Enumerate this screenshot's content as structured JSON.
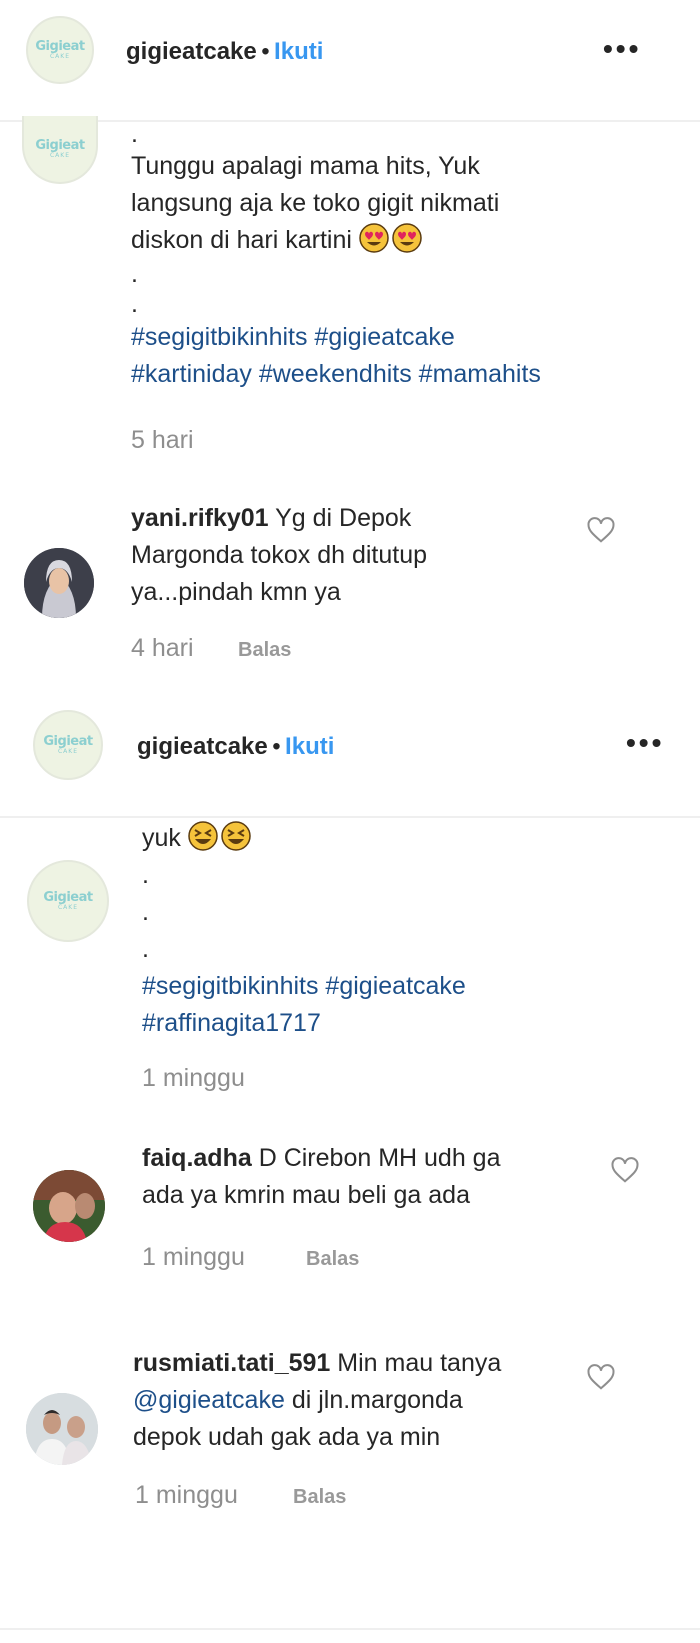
{
  "section1": {
    "header": {
      "username": "gigieatcake",
      "separator": "•",
      "follow_label": "Ikuti",
      "more_icon": "more-dots-icon"
    },
    "caption_lines": [
      ".",
      "Tunggu apalagi mama hits, Yuk",
      "langsung aja ke toko gigit nikmati",
      "diskon di hari kartini",
      ".",
      "."
    ],
    "caption_emoji": "heart-eyes-emoji",
    "hashtags_line1": "#segigitbikinhits #gigieatcake",
    "hashtags_line2": "#kartiniday #weekendhits #mamahits",
    "time": "5 hari",
    "comment": {
      "username": "yani.rifky01",
      "lines": [
        "Yg di Depok",
        "Margonda tokox dh ditutup",
        "ya...pindah kmn ya"
      ],
      "time": "4 hari",
      "reply_label": "Balas"
    }
  },
  "section2": {
    "header": {
      "username": "gigieatcake",
      "separator": "•",
      "follow_label": "Ikuti",
      "more_icon": "more-dots-icon"
    },
    "caption_first": "yuk",
    "caption_emoji": "laughing-emoji",
    "caption_dots": [
      ".",
      ".",
      "."
    ],
    "hashtags_line1": "#segigitbikinhits #gigieatcake",
    "hashtags_line2": "#raffinagita1717",
    "time": "1 minggu",
    "comments": [
      {
        "username": "faiq.adha",
        "lines": [
          "D Cirebon MH udh ga",
          "ada ya kmrin mau beli ga ada"
        ],
        "time": "1 minggu",
        "reply_label": "Balas"
      },
      {
        "username": "rusmiati.tati_591",
        "line1": "Min mau tanya",
        "mention": "@gigieatcake",
        "line2_rest": "di jln.margonda",
        "line3": "depok udah gak ada ya min",
        "time": "1 minggu",
        "reply_label": "Balas"
      }
    ]
  },
  "logo": {
    "line1": "Gigieat",
    "line2": "CAKE"
  },
  "colors": {
    "link": "#3897f0",
    "hashtag": "#1d4f89",
    "muted": "#8e8e8e",
    "text": "#262626"
  }
}
